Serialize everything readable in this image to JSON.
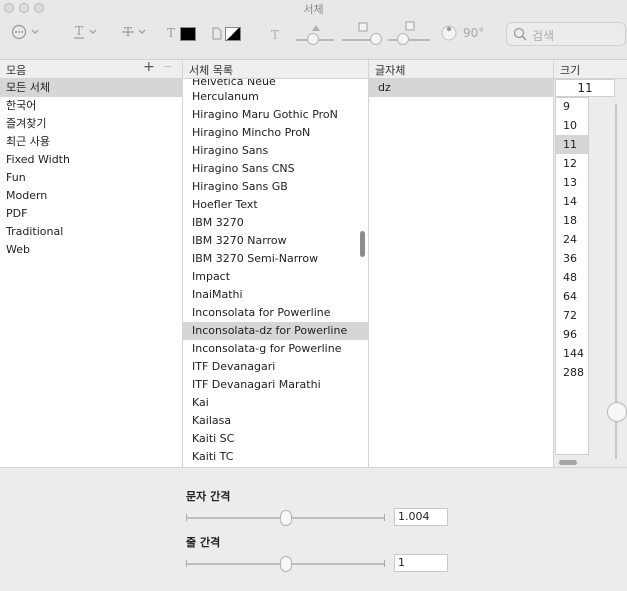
{
  "window": {
    "title": "서체"
  },
  "toolbar": {
    "search_placeholder": "검색",
    "rotation_label": "90°",
    "text_color_hex": "#000000"
  },
  "collections": {
    "header": "모음",
    "add_label": "+",
    "items": [
      "모든 서체",
      "한국어",
      "즐겨찾기",
      "최근 사용",
      "Fixed Width",
      "Fun",
      "Modern",
      "PDF",
      "Traditional",
      "Web"
    ],
    "selected": "모든 서체"
  },
  "families": {
    "header": "서체 목록",
    "items": [
      "Helvetica Neue",
      "Herculanum",
      "Hiragino Maru Gothic ProN",
      "Hiragino Mincho ProN",
      "Hiragino Sans",
      "Hiragino Sans CNS",
      "Hiragino Sans GB",
      "Hoefler Text",
      "IBM 3270",
      "IBM 3270 Narrow",
      "IBM 3270 Semi-Narrow",
      "Impact",
      "InaiMathi",
      "Inconsolata for Powerline",
      "Inconsolata-dz for Powerline",
      "Inconsolata-g for Powerline",
      "ITF Devanagari",
      "ITF Devanagari Marathi",
      "Kai",
      "Kailasa",
      "Kaiti SC",
      "Kaiti TC"
    ],
    "selected": "Inconsolata-dz for Powerline"
  },
  "typeface": {
    "header": "글자체",
    "items": [
      "dz"
    ],
    "selected": "dz"
  },
  "size": {
    "header": "크기",
    "current": "11",
    "items": [
      "9",
      "10",
      "11",
      "12",
      "13",
      "14",
      "18",
      "24",
      "36",
      "48",
      "64",
      "72",
      "96",
      "144",
      "288"
    ],
    "selected": "11"
  },
  "spacing": {
    "char_label": "문자 간격",
    "char_value": "1.004",
    "char_level": 0.5,
    "line_label": "줄 간격",
    "line_value": "1",
    "line_level": 0.5
  }
}
